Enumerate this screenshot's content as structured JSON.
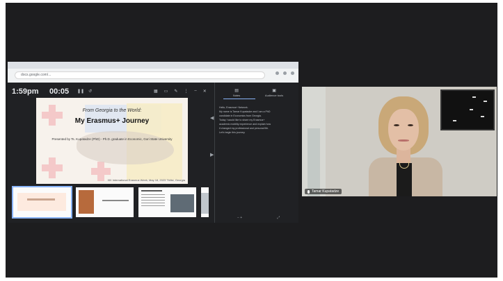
{
  "browser": {
    "url": "docs.google.com/..."
  },
  "presenter": {
    "clock": "1:59pm",
    "timer": "00:05",
    "timer_pause": "❚❚",
    "timer_reset": "↺"
  },
  "slide": {
    "subtitle": "From Georgia to the World:",
    "title": "My Erasmus+ Journey",
    "body": "Presented by Ts. Kupatadze (PhD) - Ph.D. graduate in Economic, Gori State University",
    "footer": "XIII International Erasmus Week, May 18, 2023 Tbilisi, Georgia"
  },
  "notes_panel": {
    "tab_notes": "Notes",
    "tab_questions": "Audience tools",
    "lines": [
      "Hello, Erasmus+ Network.",
      "My name is Tamar Kupatadze and I am a PhD",
      "candidate in Economics from Georgia.",
      "Today I would like to share my Erasmus+",
      "academic mobility experience and explain how",
      "it changed my professional and personal life.",
      "Let's begin this journey."
    ]
  },
  "participant": {
    "name": "Tamar Kupatadze"
  },
  "colors": {
    "frame_bg": "#1d1d1f",
    "presenter_bg": "#202124",
    "accent": "#8ab4f8"
  }
}
